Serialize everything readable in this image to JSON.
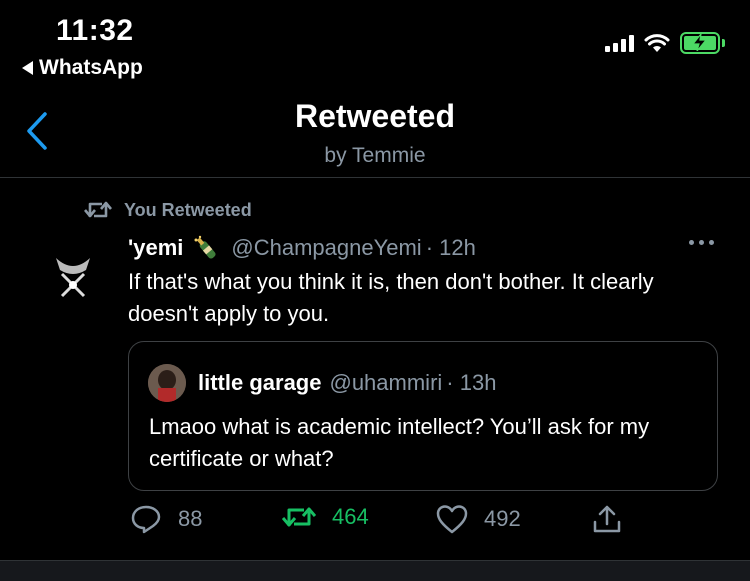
{
  "status_bar": {
    "time": "11:32",
    "back_app": "WhatsApp"
  },
  "nav": {
    "title": "Retweeted",
    "subtitle": "by Temmie"
  },
  "retweet_context": {
    "label": "You Retweeted"
  },
  "tweet": {
    "display_name": "'yemi",
    "handle": "@ChampagneYemi",
    "time": "· 12h",
    "text": "If that's what you think it is, then don't bother. It clearly doesn't apply to you."
  },
  "quoted_tweet": {
    "display_name": "little garage",
    "handle": "@uhammiri",
    "time": "· 13h",
    "text": "Lmaoo what is academic intellect? You’ll ask for my certificate or what?"
  },
  "actions": {
    "replies": "88",
    "retweets": "464",
    "likes": "492"
  },
  "colors": {
    "background": "#000000",
    "accent": "#1d9bf0",
    "retweet_green": "#17bf63",
    "muted": "#8b98a5",
    "battery": "#4cd964"
  },
  "icons": [
    "back-triangle-icon",
    "signal-icon",
    "wifi-icon",
    "battery-charging-icon",
    "chevron-left-icon",
    "retweet-icon",
    "champagne-icon",
    "more-icon",
    "reply-icon",
    "like-icon",
    "share-icon"
  ]
}
